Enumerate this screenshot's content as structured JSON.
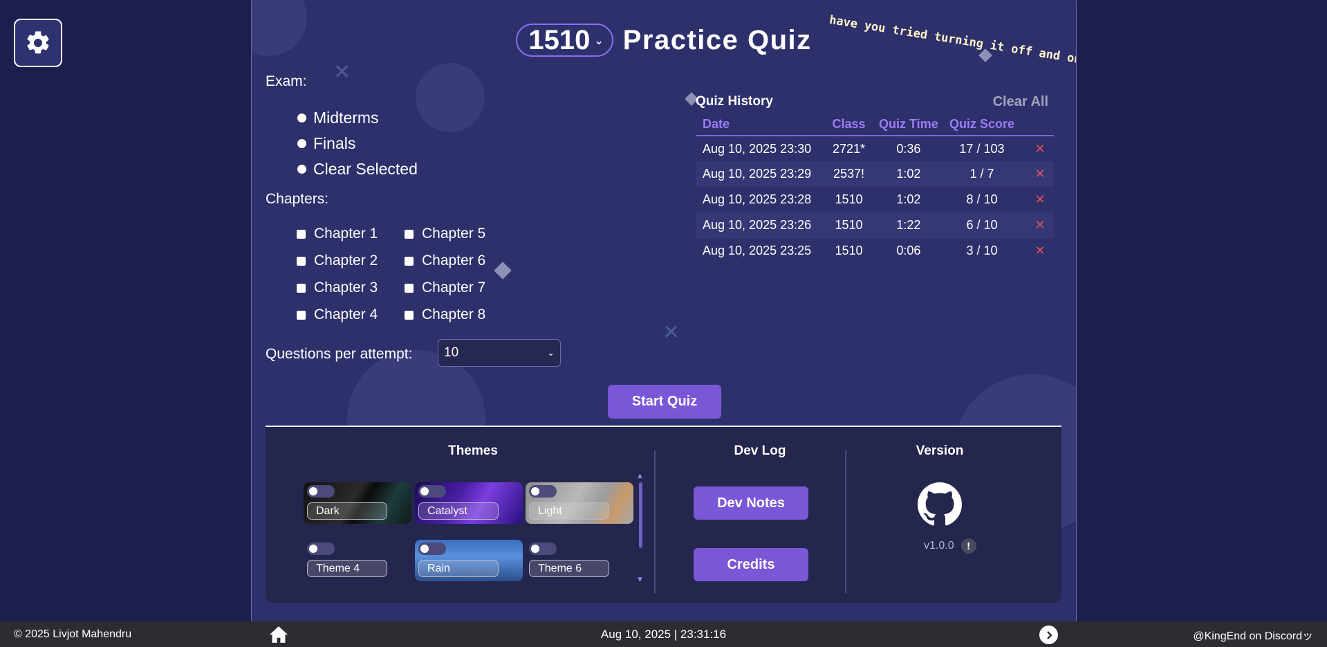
{
  "header": {
    "class_selected": "1510",
    "title": "Practice Quiz",
    "tagline": "have you tried turning it off and on again?"
  },
  "exam": {
    "label": "Exam:",
    "options": [
      "Midterms",
      "Finals",
      "Clear Selected"
    ]
  },
  "chapters": {
    "label": "Chapters:",
    "items": [
      "Chapter 1",
      "Chapter 2",
      "Chapter 3",
      "Chapter 4",
      "Chapter 5",
      "Chapter 6",
      "Chapter 7",
      "Chapter 8"
    ]
  },
  "questions": {
    "label": "Questions per attempt:",
    "value": "10"
  },
  "start_label": "Start Quiz",
  "history": {
    "title": "Quiz History",
    "clear_label": "Clear All",
    "columns": [
      "Date",
      "Class",
      "Quiz Time",
      "Quiz Score"
    ],
    "rows": [
      {
        "date": "Aug 10, 2025 23:30",
        "class": "2721*",
        "time": "0:36",
        "score": "17 / 103"
      },
      {
        "date": "Aug 10, 2025 23:29",
        "class": "2537!",
        "time": "1:02",
        "score": "1 / 7"
      },
      {
        "date": "Aug 10, 2025 23:28",
        "class": "1510",
        "time": "1:02",
        "score": "8 / 10"
      },
      {
        "date": "Aug 10, 2025 23:26",
        "class": "1510",
        "time": "1:22",
        "score": "6 / 10"
      },
      {
        "date": "Aug 10, 2025 23:25",
        "class": "1510",
        "time": "0:06",
        "score": "3 / 10"
      }
    ]
  },
  "themes": {
    "title": "Themes",
    "items": [
      "Dark",
      "Catalyst",
      "Light",
      "Theme 4",
      "Rain",
      "Theme 6"
    ]
  },
  "devlog": {
    "title": "Dev Log",
    "notes_label": "Dev Notes",
    "credits_label": "Credits"
  },
  "version": {
    "title": "Version",
    "value": "v1.0.0",
    "badge": "!"
  },
  "footer": {
    "copyright": "© 2025 Livjot Mahendru",
    "datetime": "Aug 10, 2025 | 23:31:16",
    "contact": "@KingEnd on Discordッ"
  },
  "colors": {
    "background": "#1c1f4d",
    "panel": "#2e306b",
    "accent": "#7a57d6",
    "header_text": "#9d7cf6",
    "delete": "#e25557",
    "footer": "#2b2d33"
  },
  "icons": [
    "gear-icon",
    "github-icon",
    "home-icon",
    "chevron-right-icon",
    "close-icon",
    "chevron-down-icon"
  ]
}
